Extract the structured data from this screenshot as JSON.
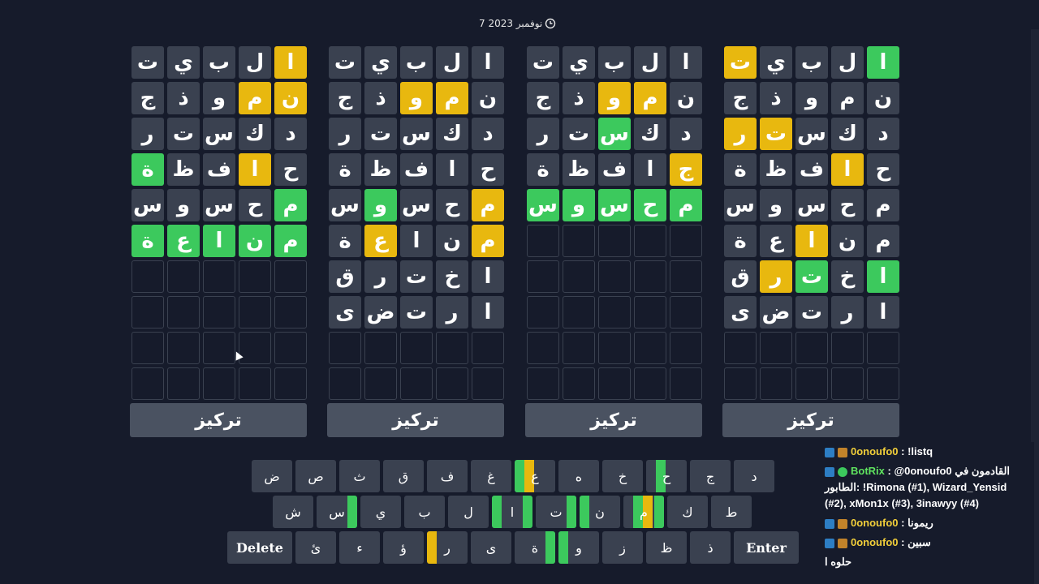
{
  "date": "7 نوفمبر 2023",
  "focus_label": "تركيز",
  "boards": [
    {
      "rows": [
        [
          {
            "l": "ا",
            "s": "g"
          },
          {
            "l": "ل",
            "s": "n"
          },
          {
            "l": "ب",
            "s": "n"
          },
          {
            "l": "ي",
            "s": "n"
          },
          {
            "l": "ت",
            "s": "y"
          }
        ],
        [
          {
            "l": "ن",
            "s": "n"
          },
          {
            "l": "م",
            "s": "n"
          },
          {
            "l": "و",
            "s": "n"
          },
          {
            "l": "ذ",
            "s": "n"
          },
          {
            "l": "ج",
            "s": "n"
          }
        ],
        [
          {
            "l": "د",
            "s": "n"
          },
          {
            "l": "ك",
            "s": "n"
          },
          {
            "l": "س",
            "s": "n"
          },
          {
            "l": "ت",
            "s": "y"
          },
          {
            "l": "ر",
            "s": "y"
          }
        ],
        [
          {
            "l": "ح",
            "s": "n"
          },
          {
            "l": "ا",
            "s": "y"
          },
          {
            "l": "ف",
            "s": "n"
          },
          {
            "l": "ظ",
            "s": "n"
          },
          {
            "l": "ة",
            "s": "n"
          }
        ],
        [
          {
            "l": "م",
            "s": "n"
          },
          {
            "l": "ح",
            "s": "n"
          },
          {
            "l": "س",
            "s": "n"
          },
          {
            "l": "و",
            "s": "n"
          },
          {
            "l": "س",
            "s": "n"
          }
        ],
        [
          {
            "l": "م",
            "s": "n"
          },
          {
            "l": "ن",
            "s": "n"
          },
          {
            "l": "ا",
            "s": "y"
          },
          {
            "l": "ع",
            "s": "n"
          },
          {
            "l": "ة",
            "s": "n"
          }
        ],
        [
          {
            "l": "ا",
            "s": "g"
          },
          {
            "l": "خ",
            "s": "n"
          },
          {
            "l": "ت",
            "s": "g"
          },
          {
            "l": "ر",
            "s": "y"
          },
          {
            "l": "ق",
            "s": "n"
          }
        ],
        [
          {
            "l": "ا",
            "s": "n"
          },
          {
            "l": "ر",
            "s": "n"
          },
          {
            "l": "ت",
            "s": "n"
          },
          {
            "l": "ض",
            "s": "n"
          },
          {
            "l": "ى",
            "s": "n"
          }
        ],
        [],
        []
      ]
    },
    {
      "rows": [
        [
          {
            "l": "ا",
            "s": "n"
          },
          {
            "l": "ل",
            "s": "n"
          },
          {
            "l": "ب",
            "s": "n"
          },
          {
            "l": "ي",
            "s": "n"
          },
          {
            "l": "ت",
            "s": "n"
          }
        ],
        [
          {
            "l": "ن",
            "s": "n"
          },
          {
            "l": "م",
            "s": "y"
          },
          {
            "l": "و",
            "s": "y"
          },
          {
            "l": "ذ",
            "s": "n"
          },
          {
            "l": "ج",
            "s": "n"
          }
        ],
        [
          {
            "l": "د",
            "s": "n"
          },
          {
            "l": "ك",
            "s": "n"
          },
          {
            "l": "س",
            "s": "g"
          },
          {
            "l": "ت",
            "s": "n"
          },
          {
            "l": "ر",
            "s": "n"
          }
        ],
        [
          {
            "l": "ج",
            "s": "y"
          },
          {
            "l": "ا",
            "s": "n"
          },
          {
            "l": "ف",
            "s": "n"
          },
          {
            "l": "ظ",
            "s": "n"
          },
          {
            "l": "ة",
            "s": "n"
          }
        ],
        [
          {
            "l": "م",
            "s": "g"
          },
          {
            "l": "ح",
            "s": "g"
          },
          {
            "l": "س",
            "s": "g"
          },
          {
            "l": "و",
            "s": "g"
          },
          {
            "l": "س",
            "s": "g"
          }
        ],
        [],
        [],
        [],
        [],
        []
      ]
    },
    {
      "rows": [
        [
          {
            "l": "ا",
            "s": "n"
          },
          {
            "l": "ل",
            "s": "n"
          },
          {
            "l": "ب",
            "s": "n"
          },
          {
            "l": "ي",
            "s": "n"
          },
          {
            "l": "ت",
            "s": "n"
          }
        ],
        [
          {
            "l": "ن",
            "s": "n"
          },
          {
            "l": "م",
            "s": "y"
          },
          {
            "l": "و",
            "s": "y"
          },
          {
            "l": "ذ",
            "s": "n"
          },
          {
            "l": "ج",
            "s": "n"
          }
        ],
        [
          {
            "l": "د",
            "s": "n"
          },
          {
            "l": "ك",
            "s": "n"
          },
          {
            "l": "س",
            "s": "n"
          },
          {
            "l": "ت",
            "s": "n"
          },
          {
            "l": "ر",
            "s": "n"
          }
        ],
        [
          {
            "l": "ح",
            "s": "n"
          },
          {
            "l": "ا",
            "s": "n"
          },
          {
            "l": "ف",
            "s": "n"
          },
          {
            "l": "ظ",
            "s": "n"
          },
          {
            "l": "ة",
            "s": "n"
          }
        ],
        [
          {
            "l": "م",
            "s": "y"
          },
          {
            "l": "ح",
            "s": "n"
          },
          {
            "l": "س",
            "s": "n"
          },
          {
            "l": "و",
            "s": "g"
          },
          {
            "l": "س",
            "s": "n"
          }
        ],
        [
          {
            "l": "م",
            "s": "y"
          },
          {
            "l": "ن",
            "s": "n"
          },
          {
            "l": "ا",
            "s": "n"
          },
          {
            "l": "ع",
            "s": "y"
          },
          {
            "l": "ة",
            "s": "n"
          }
        ],
        [
          {
            "l": "ا",
            "s": "n"
          },
          {
            "l": "خ",
            "s": "n"
          },
          {
            "l": "ت",
            "s": "n"
          },
          {
            "l": "ر",
            "s": "n"
          },
          {
            "l": "ق",
            "s": "n"
          }
        ],
        [
          {
            "l": "ا",
            "s": "n"
          },
          {
            "l": "ر",
            "s": "n"
          },
          {
            "l": "ت",
            "s": "n"
          },
          {
            "l": "ض",
            "s": "n"
          },
          {
            "l": "ى",
            "s": "n"
          }
        ],
        [],
        []
      ]
    },
    {
      "rows": [
        [
          {
            "l": "ا",
            "s": "y"
          },
          {
            "l": "ل",
            "s": "n"
          },
          {
            "l": "ب",
            "s": "n"
          },
          {
            "l": "ي",
            "s": "n"
          },
          {
            "l": "ت",
            "s": "n"
          }
        ],
        [
          {
            "l": "ن",
            "s": "y"
          },
          {
            "l": "م",
            "s": "y"
          },
          {
            "l": "و",
            "s": "n"
          },
          {
            "l": "ذ",
            "s": "n"
          },
          {
            "l": "ج",
            "s": "n"
          }
        ],
        [
          {
            "l": "د",
            "s": "n"
          },
          {
            "l": "ك",
            "s": "n"
          },
          {
            "l": "س",
            "s": "n"
          },
          {
            "l": "ت",
            "s": "n"
          },
          {
            "l": "ر",
            "s": "n"
          }
        ],
        [
          {
            "l": "ح",
            "s": "n"
          },
          {
            "l": "ا",
            "s": "y"
          },
          {
            "l": "ف",
            "s": "n"
          },
          {
            "l": "ظ",
            "s": "n"
          },
          {
            "l": "ة",
            "s": "g"
          }
        ],
        [
          {
            "l": "م",
            "s": "g"
          },
          {
            "l": "ح",
            "s": "n"
          },
          {
            "l": "س",
            "s": "n"
          },
          {
            "l": "و",
            "s": "n"
          },
          {
            "l": "س",
            "s": "n"
          }
        ],
        [
          {
            "l": "م",
            "s": "g"
          },
          {
            "l": "ن",
            "s": "g"
          },
          {
            "l": "ا",
            "s": "g"
          },
          {
            "l": "ع",
            "s": "g"
          },
          {
            "l": "ة",
            "s": "g"
          }
        ],
        [],
        [],
        [],
        []
      ]
    }
  ],
  "keyboard": {
    "rows": [
      [
        {
          "l": "د",
          "strips": []
        },
        {
          "l": "ج",
          "strips": []
        },
        {
          "l": "ح",
          "strips": [
            {
              "c": "#3cc95d",
              "x": 12
            }
          ]
        },
        {
          "l": "خ",
          "strips": []
        },
        {
          "l": "ه",
          "strips": []
        },
        {
          "l": "ع",
          "strips": [
            {
              "c": "#e8b80f",
              "x": 12
            },
            {
              "c": "#3cc95d",
              "x": 0
            }
          ]
        },
        {
          "l": "غ",
          "strips": []
        },
        {
          "l": "ف",
          "strips": []
        },
        {
          "l": "ق",
          "strips": []
        },
        {
          "l": "ث",
          "strips": []
        },
        {
          "l": "ص",
          "strips": []
        },
        {
          "l": "ض",
          "strips": []
        }
      ],
      [
        {
          "l": "ط",
          "strips": []
        },
        {
          "l": "ك",
          "strips": []
        },
        {
          "l": "م",
          "strips": [
            {
              "c": "#3cc95d",
              "x": 38
            },
            {
              "c": "#e8b80f",
              "x": 24
            },
            {
              "c": "#3cc95d",
              "x": 12
            }
          ]
        },
        {
          "l": "ن",
          "strips": [
            {
              "c": "#3cc95d",
              "x": 0
            }
          ]
        },
        {
          "l": "ت",
          "strips": [
            {
              "c": "#3cc95d",
              "x": 38
            }
          ]
        },
        {
          "l": "ا",
          "strips": [
            {
              "c": "#3cc95d",
              "x": 38
            },
            {
              "c": "#3cc95d",
              "x": 0
            }
          ]
        },
        {
          "l": "ل",
          "strips": []
        },
        {
          "l": "ب",
          "strips": []
        },
        {
          "l": "ي",
          "strips": []
        },
        {
          "l": "س",
          "strips": [
            {
              "c": "#3cc95d",
              "x": 38
            }
          ]
        },
        {
          "l": "ش",
          "strips": []
        }
      ],
      [
        {
          "l": "Enter",
          "wide": true,
          "strips": []
        },
        {
          "l": "ذ",
          "strips": []
        },
        {
          "l": "ظ",
          "strips": []
        },
        {
          "l": "ز",
          "strips": []
        },
        {
          "l": "و",
          "strips": [
            {
              "c": "#3cc95d",
              "x": 0
            }
          ]
        },
        {
          "l": "ة",
          "strips": [
            {
              "c": "#3cc95d",
              "x": 38
            }
          ]
        },
        {
          "l": "ى",
          "strips": []
        },
        {
          "l": "ر",
          "strips": [
            {
              "c": "#e8b80f",
              "x": 0
            }
          ]
        },
        {
          "l": "ؤ",
          "strips": []
        },
        {
          "l": "ء",
          "strips": []
        },
        {
          "l": "ئ",
          "strips": []
        },
        {
          "l": "Delete",
          "wide": true,
          "strips": []
        }
      ]
    ]
  },
  "chat": [
    {
      "user": "0onoufo0",
      "bot": false,
      "text": ": !listq"
    },
    {
      "user": "BotRix",
      "bot": true,
      "text": ": @0onoufo0 القادمون في الطابور: !Rimona (#1), Wizard_Yensid (#2), xMon1x (#3), 3inawyy (#4)"
    },
    {
      "user": "0onoufo0",
      "bot": false,
      "text": ": ريمونا"
    },
    {
      "user": "0onoufo0",
      "bot": false,
      "text": ": سبين"
    },
    {
      "user": "",
      "bot": false,
      "text": "حلوه ا"
    }
  ]
}
